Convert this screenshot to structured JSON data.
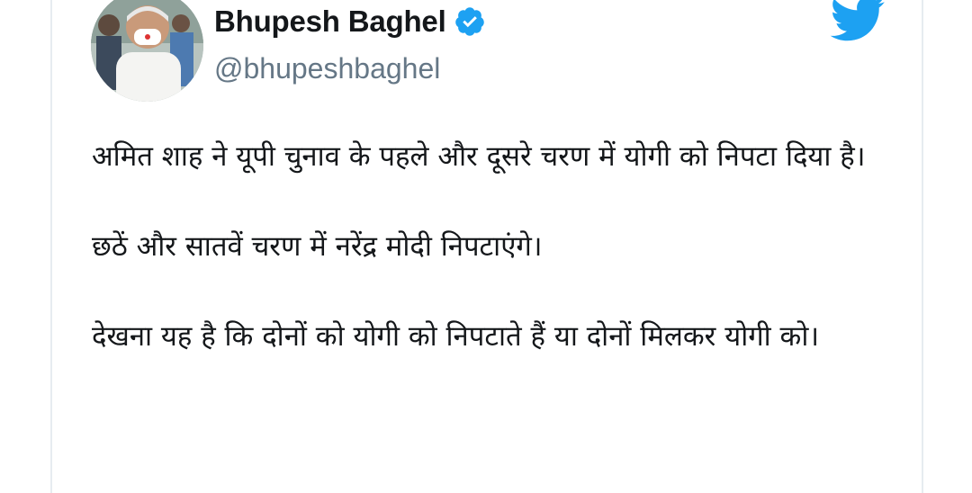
{
  "author": {
    "display_name": "Bhupesh Baghel",
    "handle": "@bhupeshbaghel",
    "verified": true
  },
  "icons": {
    "verified": "verified-badge-icon",
    "brand": "twitter-bird-icon"
  },
  "colors": {
    "twitter_blue": "#1da1f2",
    "text_primary": "#14171a",
    "text_secondary": "#657786"
  },
  "tweet": {
    "paragraphs": [
      "अमित शाह ने यूपी चुनाव के पहले और दूसरे चरण में योगी को निपटा दिया है।",
      "छठें और सातवें चरण में नरेंद्र मोदी निपटाएंगे।",
      "देखना यह है कि दोनों को योगी को निपटाते हैं या दोनों मिलकर योगी को।"
    ]
  }
}
